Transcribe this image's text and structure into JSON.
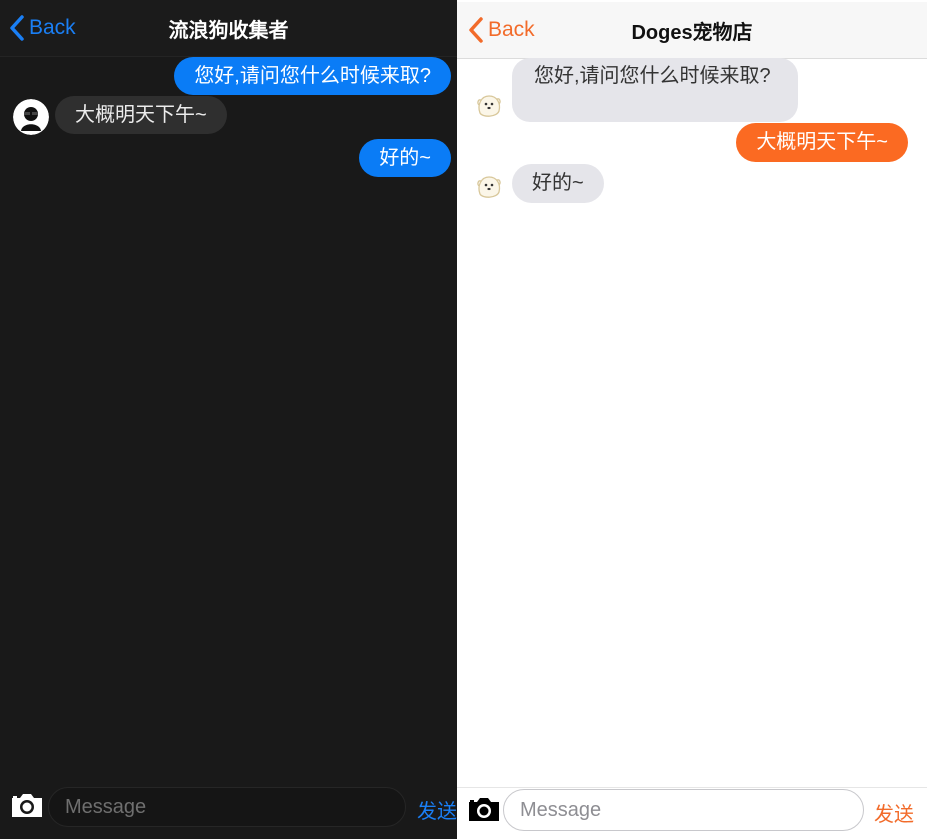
{
  "left_chat": {
    "back_label": "Back",
    "title": "流浪狗收集者",
    "messages": [
      {
        "side": "outgoing",
        "text": "您好,请问您什么时候来取?"
      },
      {
        "side": "incoming",
        "text": "大概明天下午~"
      },
      {
        "side": "outgoing",
        "text": "好的~"
      }
    ],
    "input_placeholder": "Message",
    "send_label": "发送",
    "accent_color": "#1a7ff5",
    "avatar_icon": "person-silhouette-icon"
  },
  "right_chat": {
    "back_label": "Back",
    "title": "Doges宠物店",
    "messages": [
      {
        "side": "incoming",
        "text": "您好,请问您什么时候来取?"
      },
      {
        "side": "outgoing",
        "text": "大概明天下午~"
      },
      {
        "side": "incoming",
        "text": "好的~"
      }
    ],
    "input_placeholder": "Message",
    "send_label": "发送",
    "accent_color": "#f26b2a",
    "avatar_icon": "dog-icon"
  }
}
